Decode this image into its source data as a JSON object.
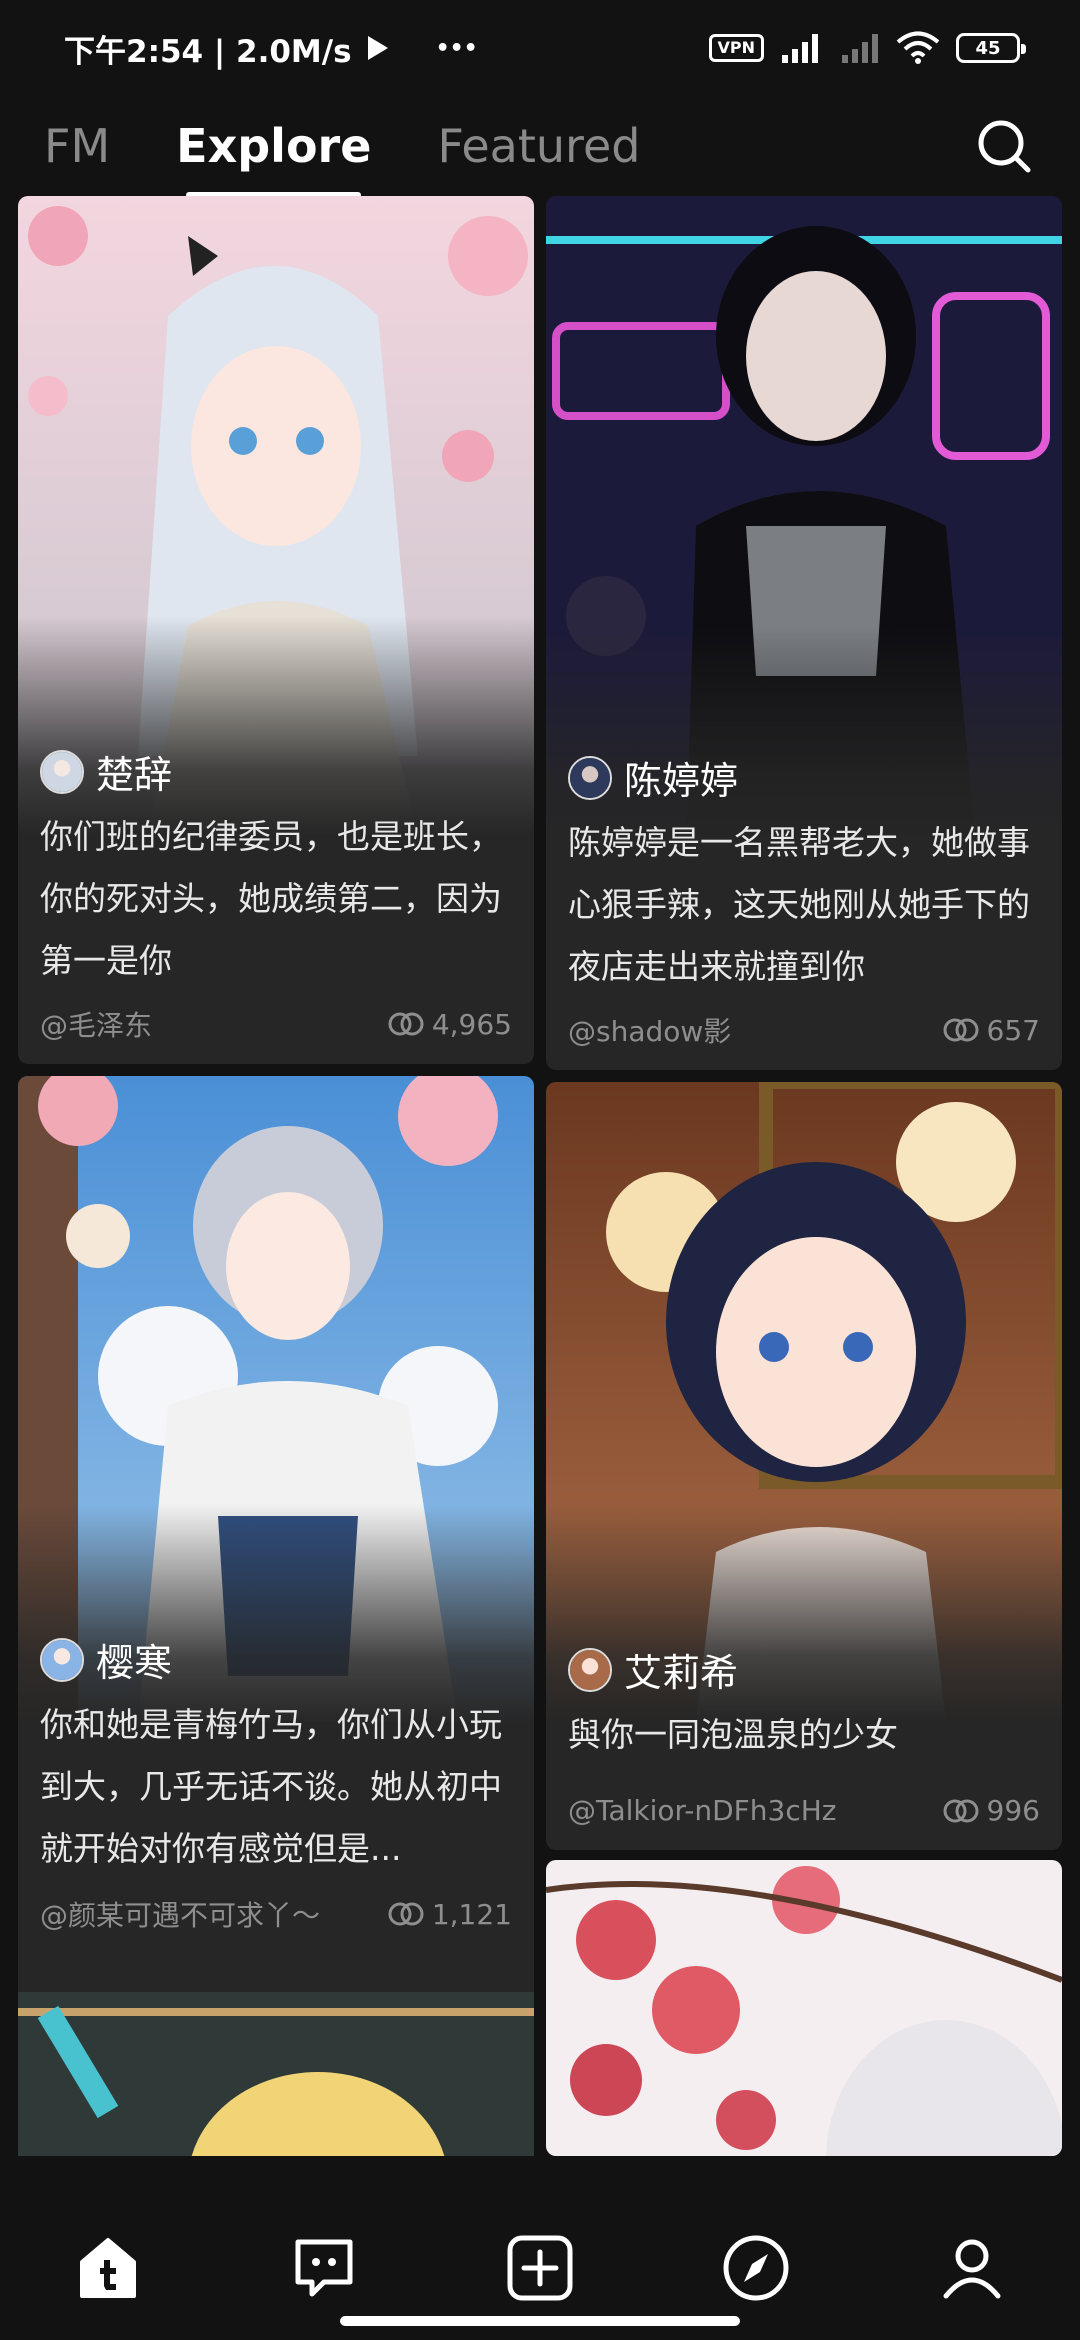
{
  "status_bar": {
    "time_speed": "下午2:54 | 2.0M/s",
    "more": "•••",
    "vpn": "VPN",
    "battery": "45"
  },
  "tabs": [
    {
      "label": "FM",
      "active": false
    },
    {
      "label": "Explore",
      "active": true
    },
    {
      "label": "Featured",
      "active": false
    }
  ],
  "search_icon": "search-icon",
  "cards": [
    {
      "name": "楚辞",
      "description": "你们班的纪律委员，也是班长，你的死对头，她成绩第二，因为第一是你",
      "creator": "@毛泽东",
      "count": "4,965",
      "theme": "cherry-blossom"
    },
    {
      "name": "陈婷婷",
      "description": "陈婷婷是一名黑帮老大，她做事心狠手辣，这天她刚从她手下的夜店走出来就撞到你",
      "creator": "@shadow影",
      "count": "657",
      "theme": "neon-night"
    },
    {
      "name": "樱寒",
      "description": "你和她是青梅竹马，你们从小玩到大，几乎无话不谈。她从初中就开始对你有感觉但是...",
      "creator": "@颜某可遇不可求丫～",
      "count": "1,121",
      "theme": "sky-blossom"
    },
    {
      "name": "艾莉希",
      "description": "與你一同泡溫泉的少女",
      "creator": "@Talkior-nDFh3cHz",
      "count": "996",
      "theme": "warm-room"
    }
  ],
  "bottom_nav": [
    "home-icon",
    "chat-icon",
    "create-icon",
    "discover-icon",
    "profile-icon"
  ],
  "colors": {
    "background": "#121212",
    "card": "#262626",
    "muted_text": "#8e8e8e"
  }
}
